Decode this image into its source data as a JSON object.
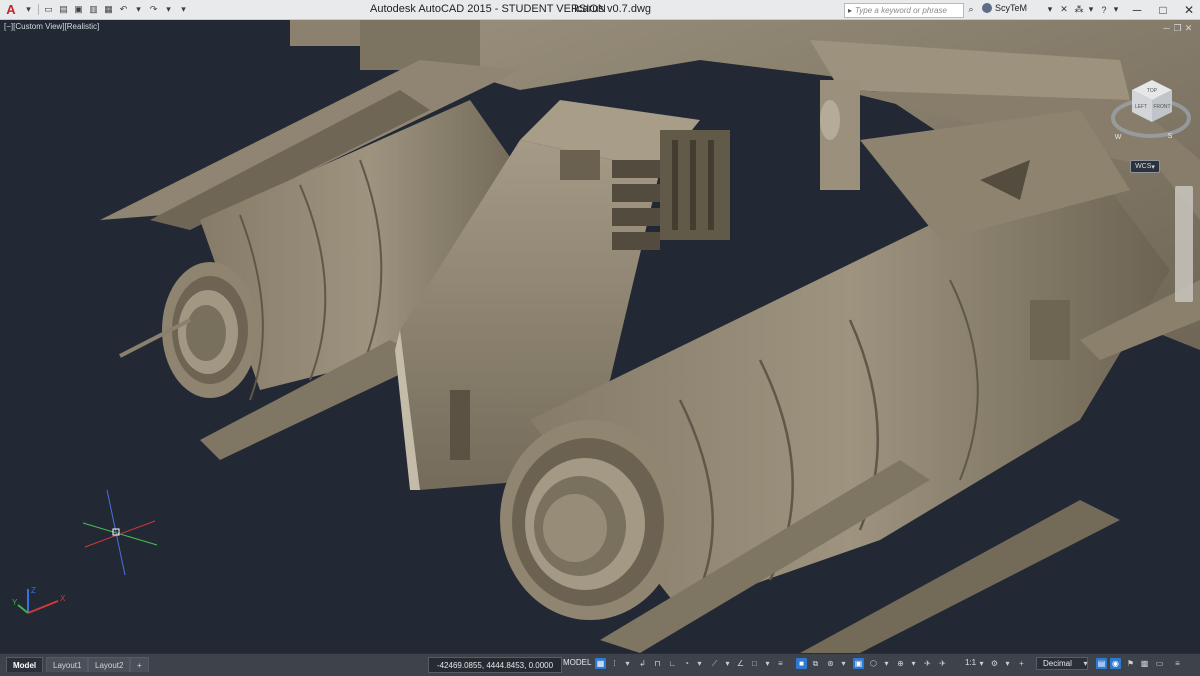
{
  "window": {
    "app_title": "Autodesk AutoCAD 2015 - STUDENT VERSION",
    "file_title": "Icarus v0.7.dwg",
    "search_placeholder": "Type a keyword or phrase",
    "user_name": "ScyTeM"
  },
  "viewport": {
    "label": "[−][Custom View][Realistic]",
    "viewcube": {
      "top": "TOP",
      "left": "LEFT",
      "front": "FRONT",
      "south": "S",
      "west": "W"
    },
    "wcs_label": "WCS ",
    "ucs_axes": {
      "x": "X",
      "y": "Y",
      "z": "Z"
    }
  },
  "layout_tabs": [
    {
      "label": "Model",
      "active": true
    },
    {
      "label": "Layout1",
      "active": false
    },
    {
      "label": "Layout2",
      "active": false
    },
    {
      "label": "+",
      "active": false
    }
  ],
  "statusbar": {
    "coordinates": "-42469.0855, 4444.8453, 0.0000",
    "space": "MODEL",
    "annotation_scale": "1:1",
    "units": "Decimal"
  },
  "colors": {
    "background": "#222834",
    "model_fill": "#8a806e",
    "accent_blue": "#2f7ad1",
    "x_axis": "#d23a3a",
    "y_axis": "#3fb24a",
    "z_axis": "#3a6fe0"
  }
}
